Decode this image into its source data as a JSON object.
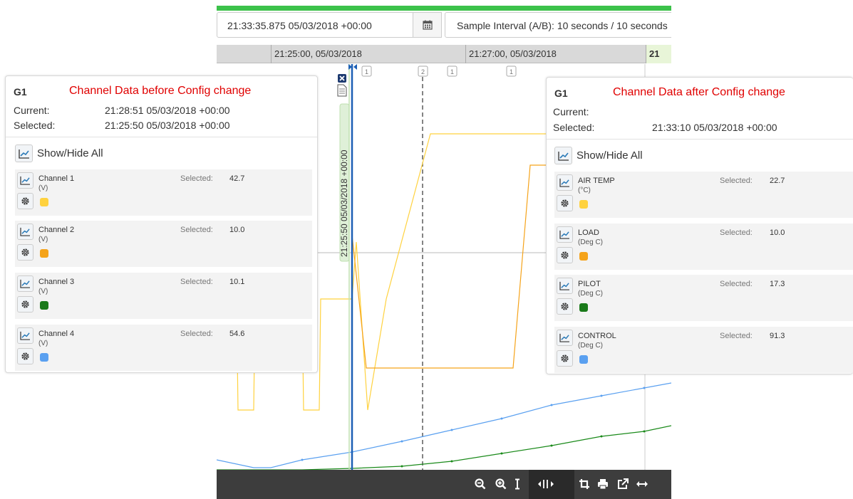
{
  "toolbar_top": {
    "datetime": "21:33:35.875 05/03/2018 +00:00",
    "sample_interval": "Sample Interval (A/B): 10 seconds / 10 seconds"
  },
  "timeaxis": {
    "tick1": "21:25:00, 05/03/2018",
    "tick2": "21:27:00, 05/03/2018",
    "tick3": "21"
  },
  "chart": {
    "cursor_label": "21:25:50 05/03/2018 +00:00",
    "markers": [
      "1",
      "1",
      "2",
      "1",
      "1"
    ]
  },
  "colors": {
    "green_bar": "#3cc24a",
    "ch1": "#ffd23f",
    "ch2": "#f5a31a",
    "ch3": "#1a8a1a",
    "ch4": "#5aa0f0",
    "red_annotation": "#e00000"
  },
  "panel_left": {
    "group": "G1",
    "annotation": "Channel Data before Config change",
    "current_label": "Current:",
    "current_value": "21:28:51 05/03/2018 +00:00",
    "selected_label": "Selected:",
    "selected_value": "21:25:50 05/03/2018 +00:00",
    "show_hide": "Show/Hide All",
    "channels": [
      {
        "name": "Channel 1",
        "unit": "(V)",
        "sel_label": "Selected:",
        "value": "42.7"
      },
      {
        "name": "Channel 2",
        "unit": "(V)",
        "sel_label": "Selected:",
        "value": "10.0"
      },
      {
        "name": "Channel 3",
        "unit": "(V)",
        "sel_label": "Selected:",
        "value": "10.1"
      },
      {
        "name": "Channel 4",
        "unit": "(V)",
        "sel_label": "Selected:",
        "value": "54.6"
      }
    ]
  },
  "panel_right": {
    "group": "G1",
    "annotation": "Channel Data after Config change",
    "current_label": "Current:",
    "current_value": "",
    "selected_label": "Selected:",
    "selected_value": "21:33:10 05/03/2018 +00:00",
    "show_hide": "Show/Hide All",
    "channels": [
      {
        "name": "AIR TEMP",
        "unit": "(°C)",
        "sel_label": "Selected:",
        "value": "22.7"
      },
      {
        "name": "LOAD",
        "unit": "(Deg C)",
        "sel_label": "Selected:",
        "value": "10.0"
      },
      {
        "name": "PILOT",
        "unit": "(Deg C)",
        "sel_label": "Selected:",
        "value": "17.3"
      },
      {
        "name": "CONTROL",
        "unit": "(Deg C)",
        "sel_label": "Selected:",
        "value": "91.3"
      }
    ]
  },
  "bottom_toolbar": {
    "icons": [
      "zoom-out-icon",
      "zoom-in-icon",
      "vertical-scale-icon",
      "cursor-mode-icon",
      "crop-icon",
      "print-icon",
      "popout-icon",
      "horizontal-fit-icon"
    ]
  }
}
